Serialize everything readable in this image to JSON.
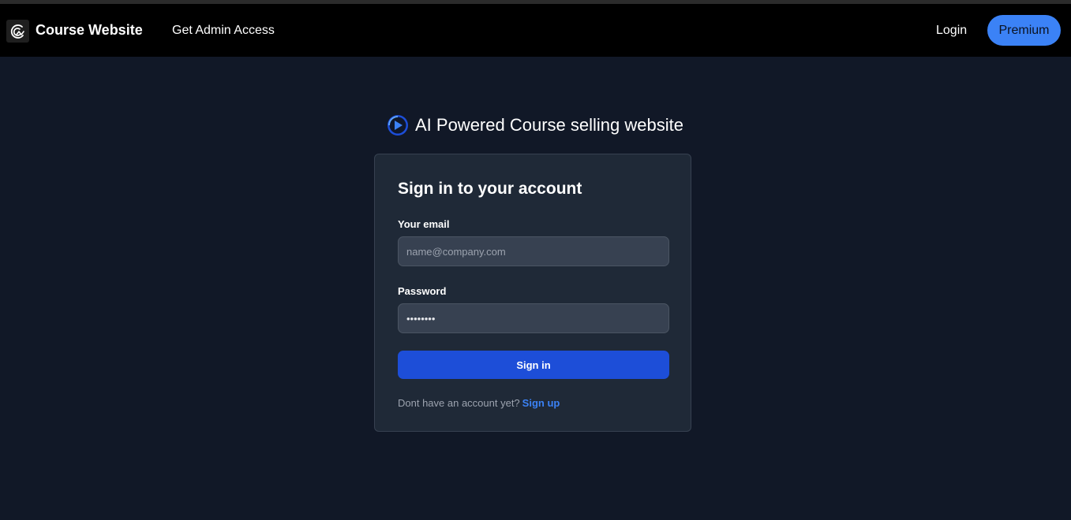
{
  "navbar": {
    "brand_name": "Course Website",
    "admin_link": "Get Admin Access",
    "login_link": "Login",
    "premium_button": "Premium",
    "logo_icon": "course-logo-icon"
  },
  "hero": {
    "title": "AI Powered Course selling website",
    "icon": "play-logo-icon"
  },
  "signin_form": {
    "title": "Sign in to your account",
    "email_label": "Your email",
    "email_placeholder": "name@company.com",
    "email_value": "",
    "password_label": "Password",
    "password_value": "••••••••",
    "submit_button": "Sign in",
    "signup_prompt": "Dont have an account yet?",
    "signup_link": "Sign up"
  },
  "colors": {
    "page_background": "#111827",
    "navbar_background": "#000000",
    "card_background": "#1f2937",
    "accent": "#3b82f6",
    "button": "#1d4ed8"
  }
}
